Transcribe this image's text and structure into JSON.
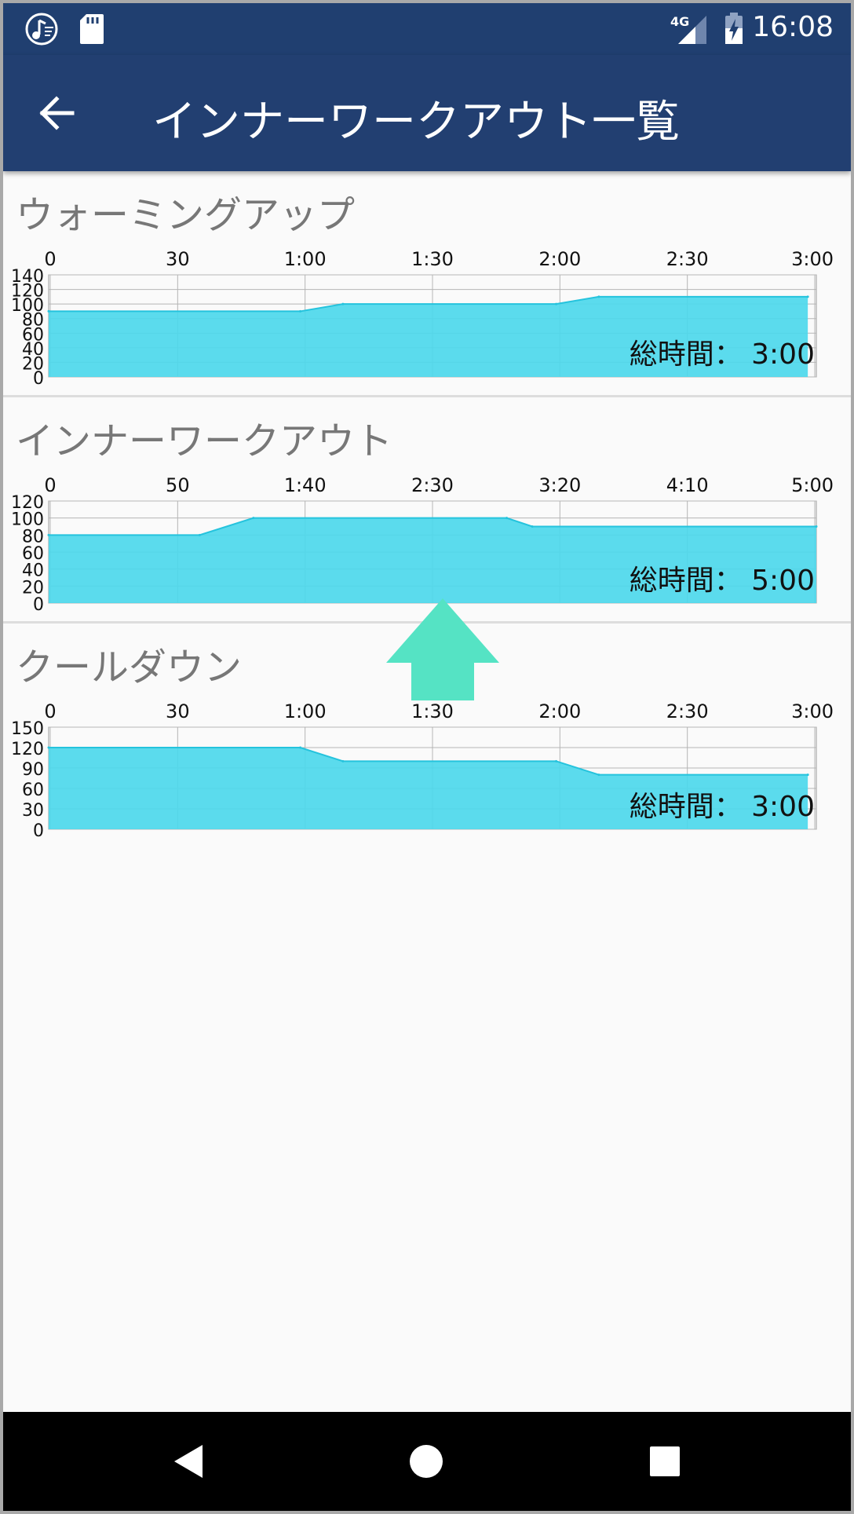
{
  "status_bar": {
    "time": "16:08",
    "network": "4G",
    "icons": [
      "music-app-icon",
      "sd-card-icon",
      "signal-icon",
      "battery-charging-icon"
    ]
  },
  "app_bar": {
    "title": "インナーワークアウト一覧",
    "back_icon": "arrow-left-icon"
  },
  "colors": {
    "status_bar": "#203f70",
    "app_bar": "#223f71",
    "chart_fill": "#4dd8ec",
    "chart_stroke": "#25c3dd",
    "arrow": "#55e3c4"
  },
  "sections": [
    {
      "title": "ウォーミングアップ",
      "total_label": "総時間： 3:00",
      "chart_data": {
        "type": "area",
        "x_ticks": [
          "0",
          "30",
          "1:00",
          "1:30",
          "2:00",
          "2:30",
          "3:00"
        ],
        "y_ticks": [
          "140",
          "120",
          "100",
          "80",
          "60",
          "40",
          "20",
          "0"
        ],
        "ylim": [
          0,
          140
        ],
        "xlim": [
          0,
          180
        ],
        "x": [
          0,
          59,
          69,
          119,
          129,
          178
        ],
        "values": [
          90,
          90,
          100,
          100,
          110,
          110
        ]
      }
    },
    {
      "title": "インナーワークアウト",
      "total_label": "総時間： 5:00",
      "chart_data": {
        "type": "area",
        "x_ticks": [
          "0",
          "50",
          "1:40",
          "2:30",
          "3:20",
          "4:10",
          "5:00"
        ],
        "y_ticks": [
          "120",
          "100",
          "80",
          "60",
          "40",
          "20",
          "0"
        ],
        "ylim": [
          0,
          120
        ],
        "xlim": [
          0,
          300
        ],
        "x": [
          0,
          59,
          80,
          179,
          189,
          300
        ],
        "values": [
          80,
          80,
          100,
          100,
          90,
          90
        ]
      }
    },
    {
      "title": "クールダウン",
      "total_label": "総時間： 3:00",
      "chart_data": {
        "type": "area",
        "x_ticks": [
          "0",
          "30",
          "1:00",
          "1:30",
          "2:00",
          "2:30",
          "3:00"
        ],
        "y_ticks": [
          "150",
          "120",
          "90",
          "60",
          "30",
          "0"
        ],
        "ylim": [
          0,
          150
        ],
        "xlim": [
          0,
          180
        ],
        "x": [
          0,
          59,
          69,
          119,
          129,
          178
        ],
        "values": [
          120,
          120,
          100,
          100,
          80,
          80
        ]
      }
    }
  ],
  "nav_bar": {
    "buttons": [
      "nav-back-icon",
      "nav-home-icon",
      "nav-recents-icon"
    ]
  }
}
